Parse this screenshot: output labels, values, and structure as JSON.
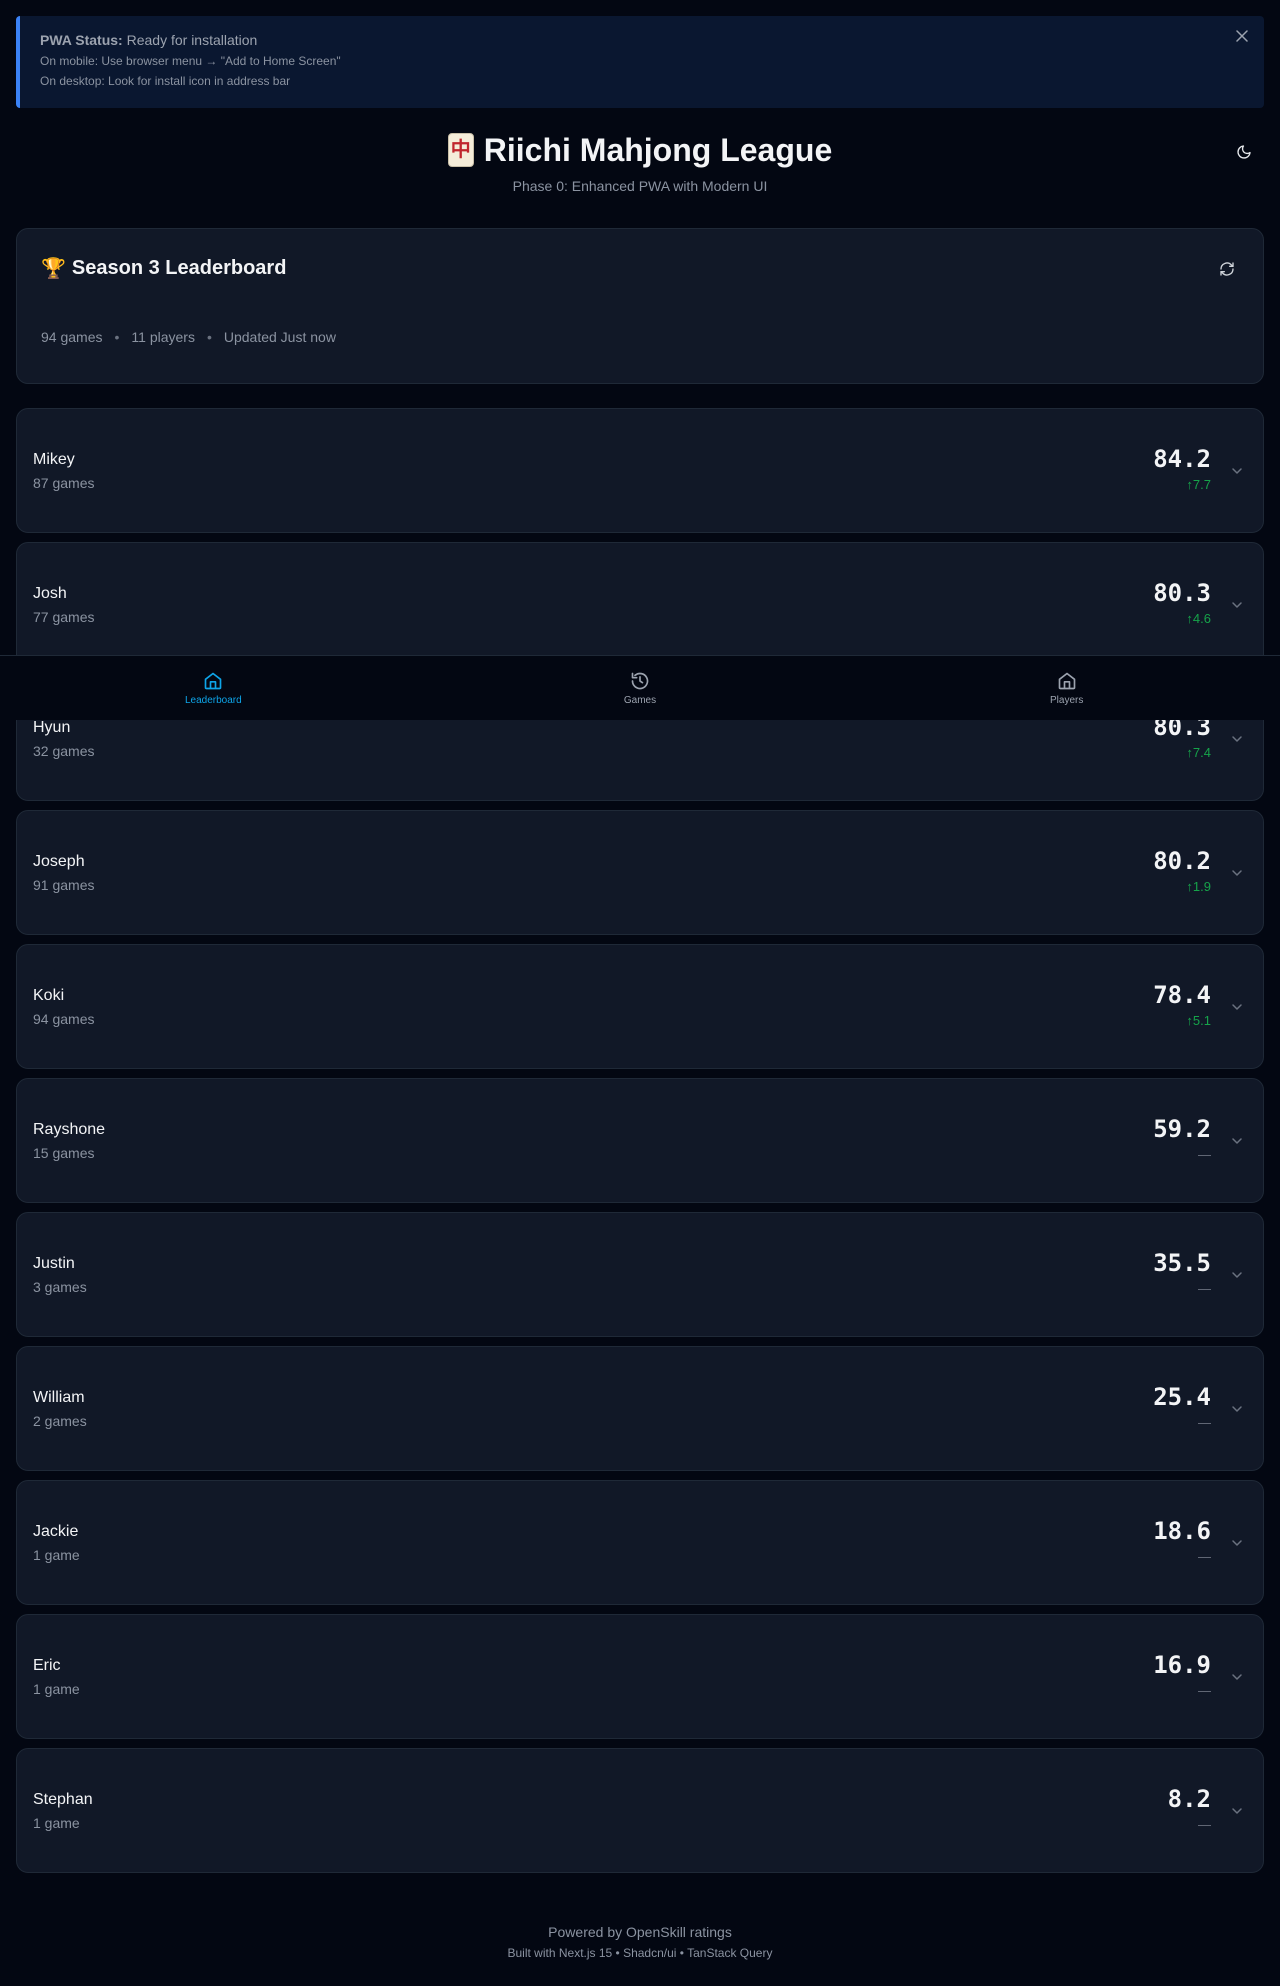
{
  "pwa_banner": {
    "status_label": "PWA Status:",
    "status_value": "Ready for installation",
    "mobile_hint": "On mobile: Use browser menu → \"Add to Home Screen\"",
    "desktop_hint": "On desktop: Look for install icon in address bar",
    "close_icon": "close-icon"
  },
  "header": {
    "tile_glyph": "中",
    "title": "Riichi Mahjong League",
    "subtitle": "Phase 0: Enhanced PWA with Modern UI",
    "theme_icon": "moon-icon"
  },
  "season": {
    "trophy": "🏆",
    "title": "Season 3 Leaderboard",
    "games": "94 games",
    "players": "11 players",
    "updated": "Updated Just now",
    "separator": "•",
    "refresh_icon": "refresh-icon"
  },
  "players": [
    {
      "name": "Mikey",
      "games": "87 games",
      "rating": "84.2",
      "delta": "↑7.7",
      "trend": "up"
    },
    {
      "name": "Josh",
      "games": "77 games",
      "rating": "80.3",
      "delta": "↑4.6",
      "trend": "up"
    },
    {
      "name": "Hyun",
      "games": "32 games",
      "rating": "80.3",
      "delta": "↑7.4",
      "trend": "up"
    },
    {
      "name": "Joseph",
      "games": "91 games",
      "rating": "80.2",
      "delta": "↑1.9",
      "trend": "up"
    },
    {
      "name": "Koki",
      "games": "94 games",
      "rating": "78.4",
      "delta": "↑5.1",
      "trend": "up"
    },
    {
      "name": "Rayshone",
      "games": "15 games",
      "rating": "59.2",
      "delta": "—",
      "trend": "none"
    },
    {
      "name": "Justin",
      "games": "3 games",
      "rating": "35.5",
      "delta": "—",
      "trend": "none"
    },
    {
      "name": "William",
      "games": "2 games",
      "rating": "25.4",
      "delta": "—",
      "trend": "none"
    },
    {
      "name": "Jackie",
      "games": "1 game",
      "rating": "18.6",
      "delta": "—",
      "trend": "none"
    },
    {
      "name": "Eric",
      "games": "1 game",
      "rating": "16.9",
      "delta": "—",
      "trend": "none"
    },
    {
      "name": "Stephan",
      "games": "1 game",
      "rating": "8.2",
      "delta": "—",
      "trend": "none"
    }
  ],
  "bottom_nav": {
    "items": [
      {
        "label": "Leaderboard",
        "icon": "home-icon",
        "active": true
      },
      {
        "label": "Games",
        "icon": "history-icon",
        "active": false
      },
      {
        "label": "Players",
        "icon": "home-icon",
        "active": false
      }
    ]
  },
  "footer": {
    "line1": "Powered by OpenSkill ratings",
    "line2": "Built with Next.js 15 • Shadcn/ui • TanStack Query"
  },
  "colors": {
    "background": "#030712",
    "card": "#111827",
    "accent": "#0ea5e9",
    "banner_accent": "#3b82f6",
    "delta_up": "#16a34a"
  }
}
